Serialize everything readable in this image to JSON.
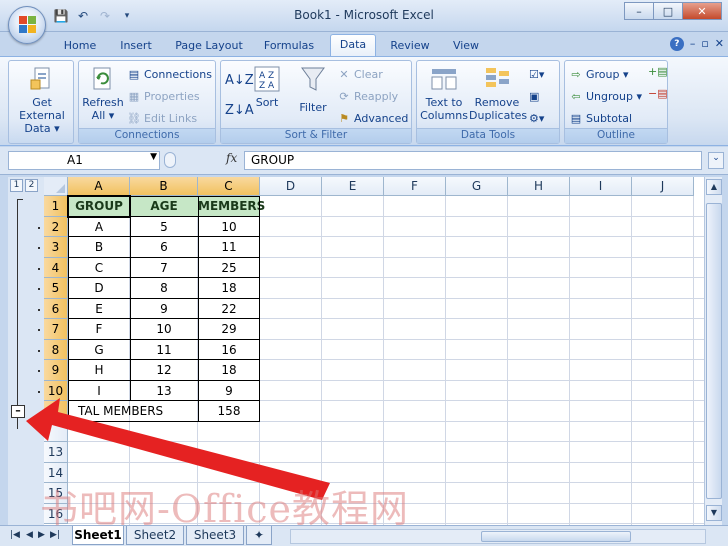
{
  "window": {
    "title": "Book1 - Microsoft Excel",
    "controls": [
      "–",
      "□",
      "✕"
    ]
  },
  "qat": [
    "💾",
    "↶",
    "↷",
    "▾"
  ],
  "tabs": [
    "Home",
    "Insert",
    "Page Layout",
    "Formulas",
    "Data",
    "Review",
    "View"
  ],
  "active_tab": "Data",
  "ribbon": {
    "get_external": {
      "line1": "Get External",
      "line2": "Data ▾"
    },
    "refresh": {
      "line1": "Refresh",
      "line2": "All ▾"
    },
    "connections_items": [
      "Connections",
      "Properties",
      "Edit Links"
    ],
    "connections_label": "Connections",
    "sort": "Sort",
    "filter": "Filter",
    "clear": "Clear",
    "reapply": "Reapply",
    "advanced": "Advanced",
    "sortfilter_label": "Sort & Filter",
    "text_to_columns": {
      "line1": "Text to",
      "line2": "Columns"
    },
    "remove_duplicates": {
      "line1": "Remove",
      "line2": "Duplicates"
    },
    "datatools_label": "Data Tools",
    "group": "Group ▾",
    "ungroup": "Ungroup ▾",
    "subtotal": "Subtotal",
    "outline_label": "Outline"
  },
  "formula_bar": {
    "name_box": "A1",
    "fx": "fx",
    "content": "GROUP"
  },
  "outline_levels": [
    "1",
    "2"
  ],
  "columns": [
    "A",
    "B",
    "C",
    "D",
    "E",
    "F",
    "G",
    "H",
    "I",
    "J"
  ],
  "rows": [
    "1",
    "2",
    "3",
    "4",
    "5",
    "6",
    "7",
    "8",
    "9",
    "10",
    "",
    "",
    "13",
    "14",
    "15",
    "16"
  ],
  "table": {
    "headers": [
      "GROUP",
      "AGE",
      "MEMBERS"
    ],
    "data": [
      [
        "A",
        "5",
        "10"
      ],
      [
        "B",
        "6",
        "11"
      ],
      [
        "C",
        "7",
        "25"
      ],
      [
        "D",
        "8",
        "18"
      ],
      [
        "E",
        "9",
        "22"
      ],
      [
        "F",
        "10",
        "29"
      ],
      [
        "G",
        "11",
        "16"
      ],
      [
        "H",
        "12",
        "18"
      ],
      [
        "I",
        "13",
        "9"
      ]
    ],
    "total_label": "TAL MEMBERS",
    "total_value": "158"
  },
  "sheets": [
    "Sheet1",
    "Sheet2",
    "Sheet3"
  ],
  "watermark": "书吧网-Office教程网"
}
